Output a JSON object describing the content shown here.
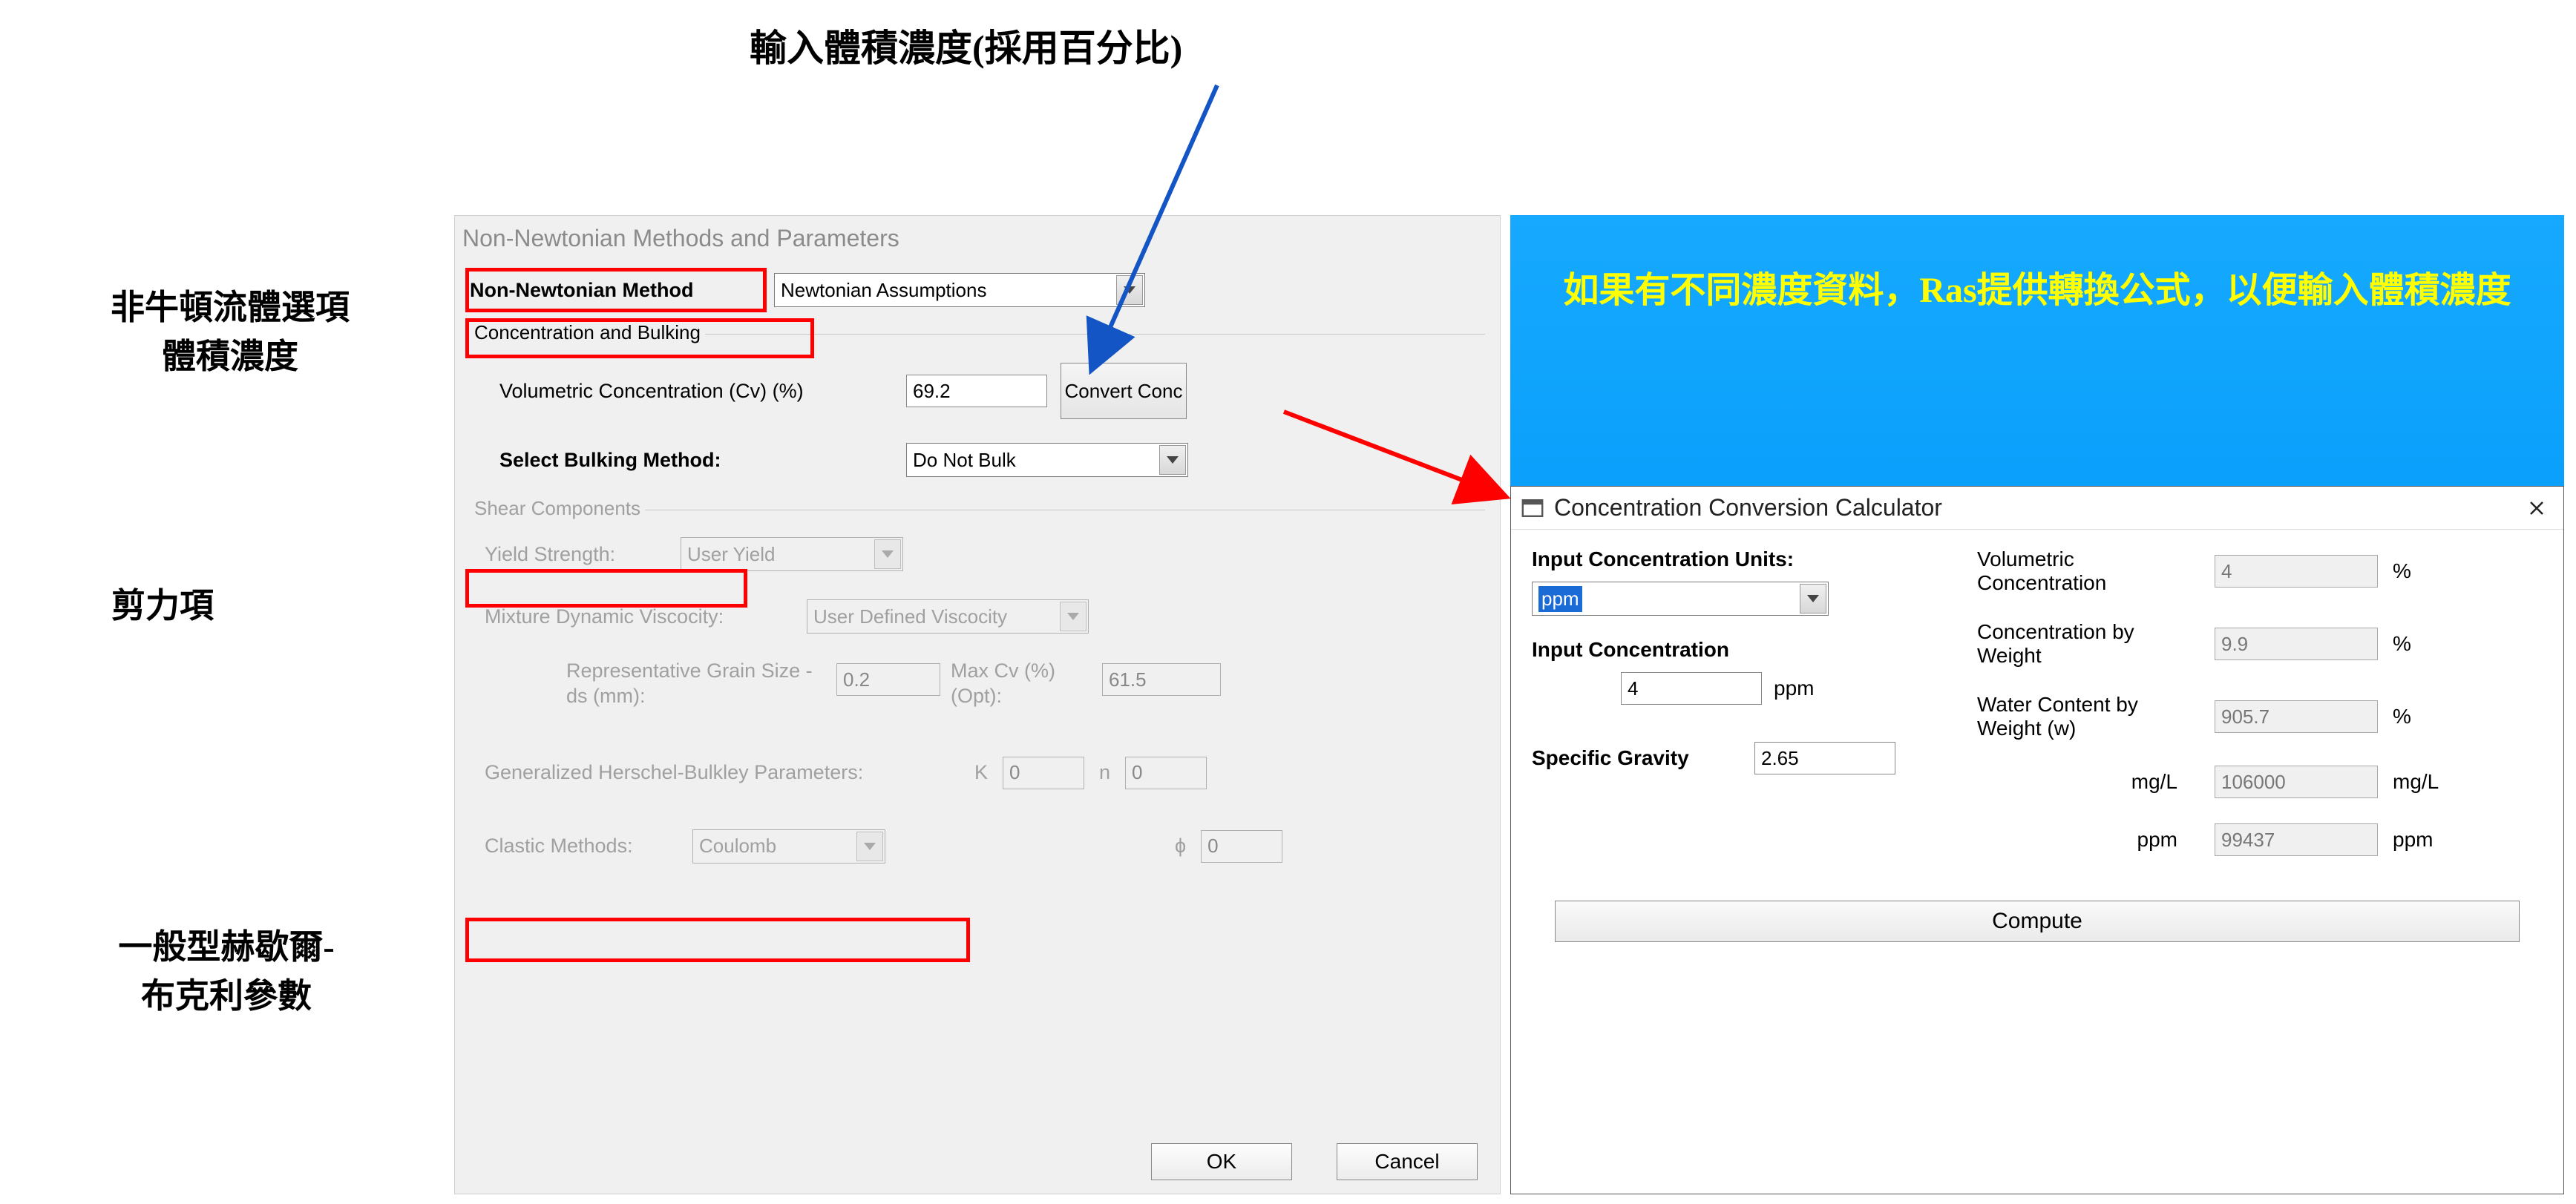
{
  "annotations": {
    "top": "輸入體積濃度(採用百分比)",
    "left1a": "非牛頓流體選項",
    "left1b": "體積濃度",
    "left2": "剪力項",
    "left3a": "一般型赫歇爾-",
    "left3b": "布克利參數",
    "blue": "如果有不同濃度資料，Ras提供轉換公式，以便輸入體積濃度"
  },
  "main": {
    "title": "Non-Newtonian Methods and Parameters",
    "method_label": "Non-Newtonian Method",
    "method_value": "Newtonian Assumptions",
    "section_conc": "Concentration and Bulking",
    "cv_label": "Volumetric Concentration (Cv) (%)",
    "cv_value": "69.2",
    "convert_btn": "Convert Conc",
    "bulking_label": "Select Bulking Method:",
    "bulking_value": "Do Not Bulk",
    "section_shear": "Shear Components",
    "yield_label": "Yield Strength:",
    "yield_value": "User Yield",
    "visc_label": "Mixture Dynamic Viscocity:",
    "visc_value": "User Defined Viscocity",
    "grain_label": "Representative Grain Size - ds (mm):",
    "grain_value": "0.2",
    "maxcv_label": "Max Cv (%) (Opt):",
    "maxcv_value": "61.5",
    "hb_label": "Generalized Herschel-Bulkley Parameters:",
    "k_label": "K",
    "k_value": "0",
    "n_label": "n",
    "n_value": "0",
    "clastic_label": "Clastic Methods:",
    "clastic_value": "Coulomb",
    "phi_label": "ϕ",
    "phi_value": "0",
    "ok": "OK",
    "cancel": "Cancel"
  },
  "ccc": {
    "title": "Concentration Conversion Calculator",
    "input_units_label": "Input Concentration Units:",
    "input_units_value": "ppm",
    "input_conc_label": "Input Concentration",
    "input_conc_value": "4",
    "input_conc_unit": "ppm",
    "sg_label": "Specific Gravity",
    "sg_value": "2.65",
    "vol_conc_label": "Volumetric Concentration",
    "vol_conc_value": "4",
    "vol_conc_unit": "%",
    "cw_label": "Concentration by Weight",
    "cw_value": "9.9",
    "cw_unit": "%",
    "wcw_label": "Water Content by Weight (w)",
    "wcw_value": "905.7",
    "wcw_unit": "%",
    "mgl_label": "mg/L",
    "mgl_value": "106000",
    "mgl_unit": "mg/L",
    "ppm_label": "ppm",
    "ppm_value": "99437",
    "ppm_unit": "ppm",
    "compute": "Compute"
  }
}
